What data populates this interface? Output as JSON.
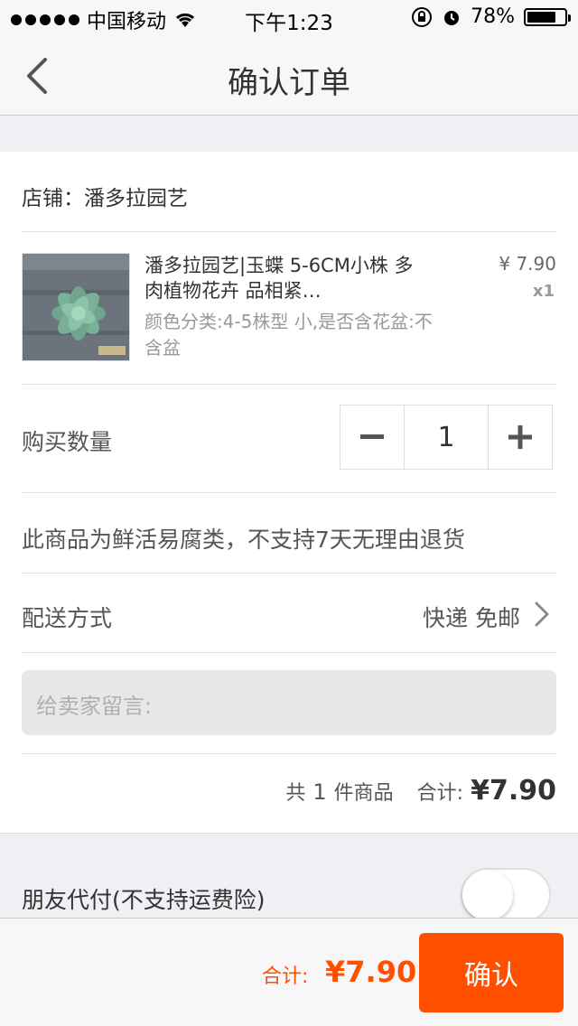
{
  "status_bar": {
    "carrier": "中国移动",
    "time": "下午1:23",
    "battery": "78%",
    "battery_level": 0.78
  },
  "nav": {
    "title": "确认订单"
  },
  "store": {
    "label": "店铺：潘多拉园艺"
  },
  "product": {
    "title": "潘多拉园艺|玉蝶 5-6CM小株 多肉植物花卉 品相紧…",
    "spec": "颜色分类:4-5株型 小,是否含花盆:不含盆",
    "price": "¥ 7.90",
    "qty": "x1"
  },
  "quantity": {
    "label": "购买数量",
    "value": "1",
    "minus_icon": "minus-icon",
    "plus_icon": "plus-icon"
  },
  "notice": "此商品为鲜活易腐类，不支持7天无理由退货",
  "shipping": {
    "label": "配送方式",
    "value": "快递 免邮"
  },
  "message": {
    "placeholder": "给卖家留言:"
  },
  "summary": {
    "prefix": "共",
    "count": "1",
    "suffix": "件商品",
    "total_label": "合计:",
    "total_amount": "¥7.90"
  },
  "friend_pay": {
    "label": "朋友代付(不支持运费险)",
    "enabled": false
  },
  "bottom": {
    "total_label": "合计:",
    "total_amount": "¥7.90",
    "confirm_label": "确认"
  },
  "colors": {
    "accent": "#ff5000",
    "background": "#efeff4"
  }
}
